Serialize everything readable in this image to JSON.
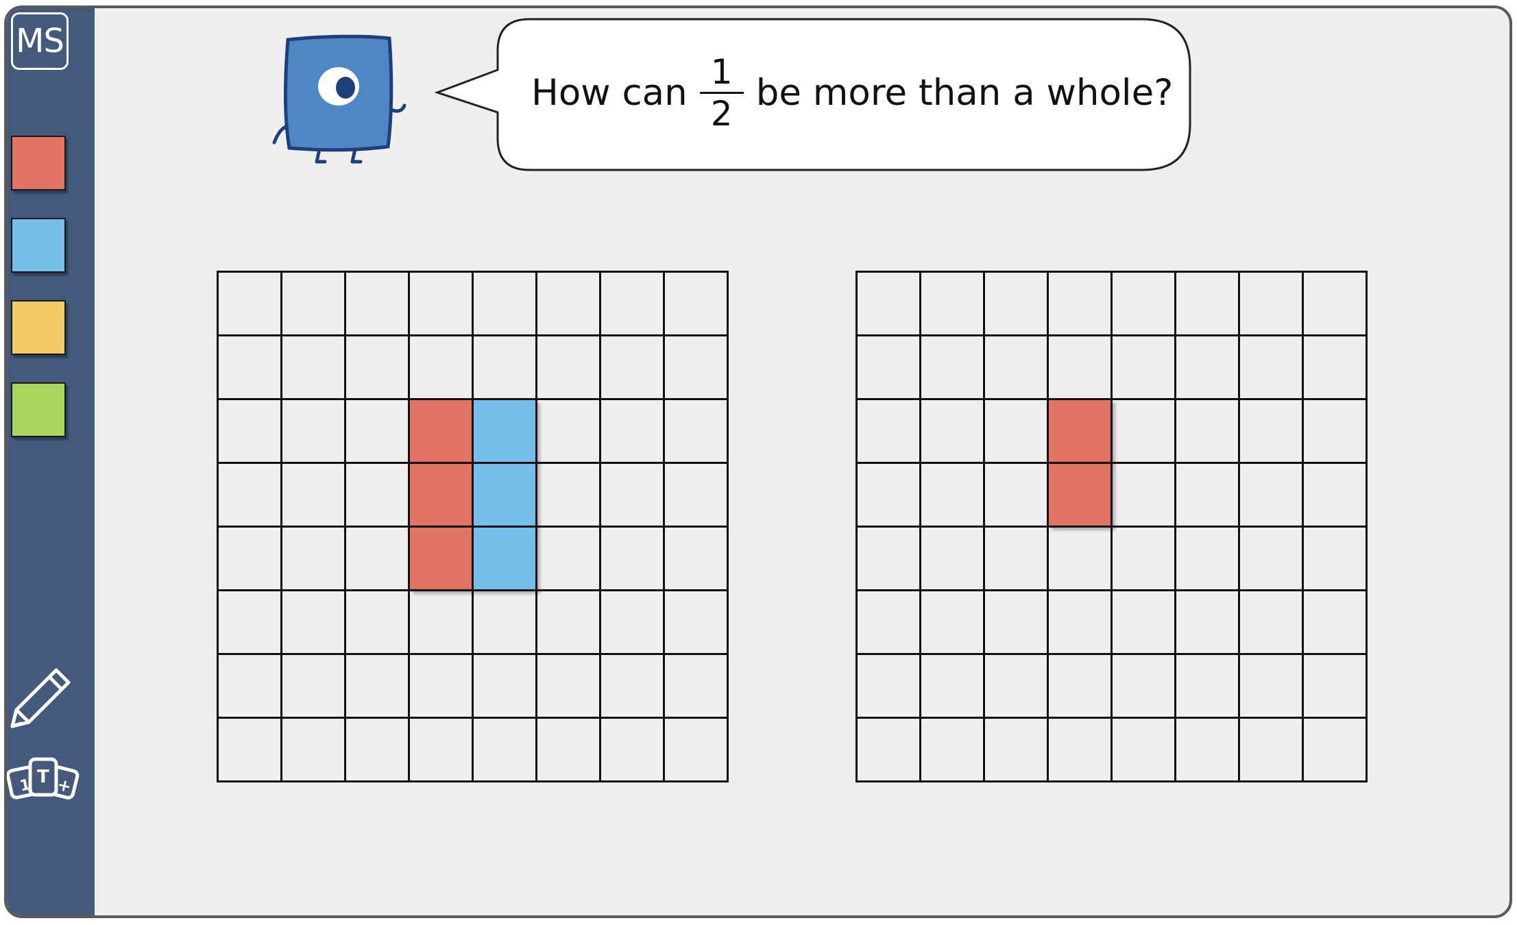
{
  "sidebar": {
    "user_initials": "MS",
    "palette": [
      {
        "name": "red",
        "color": "#e07362"
      },
      {
        "name": "blue",
        "color": "#76bfea"
      },
      {
        "name": "yellow",
        "color": "#f2cb67"
      },
      {
        "name": "green",
        "color": "#a8d65e"
      }
    ],
    "tools": [
      "pencil-icon",
      "number-tiles-icon"
    ],
    "tiles_glyphs": [
      "1",
      "T",
      "+"
    ]
  },
  "prompt": {
    "before": "How can",
    "fraction_numerator": "1",
    "fraction_denominator": "2",
    "after": "be more than a whole?"
  },
  "colors": {
    "sidebar": "#445a7c",
    "canvas": "#efefef",
    "character": "#4f86c6",
    "red_tile": "#e07362",
    "blue_tile": "#76bfea"
  },
  "grids": [
    {
      "rows": 8,
      "cols": 8,
      "filled": [
        {
          "row": 2,
          "col": 3,
          "color": "red"
        },
        {
          "row": 3,
          "col": 3,
          "color": "red"
        },
        {
          "row": 4,
          "col": 3,
          "color": "red"
        },
        {
          "row": 2,
          "col": 4,
          "color": "blue"
        },
        {
          "row": 3,
          "col": 4,
          "color": "blue"
        },
        {
          "row": 4,
          "col": 4,
          "color": "blue"
        }
      ]
    },
    {
      "rows": 8,
      "cols": 8,
      "filled": [
        {
          "row": 2,
          "col": 3,
          "color": "red"
        },
        {
          "row": 3,
          "col": 3,
          "color": "red"
        }
      ]
    }
  ]
}
